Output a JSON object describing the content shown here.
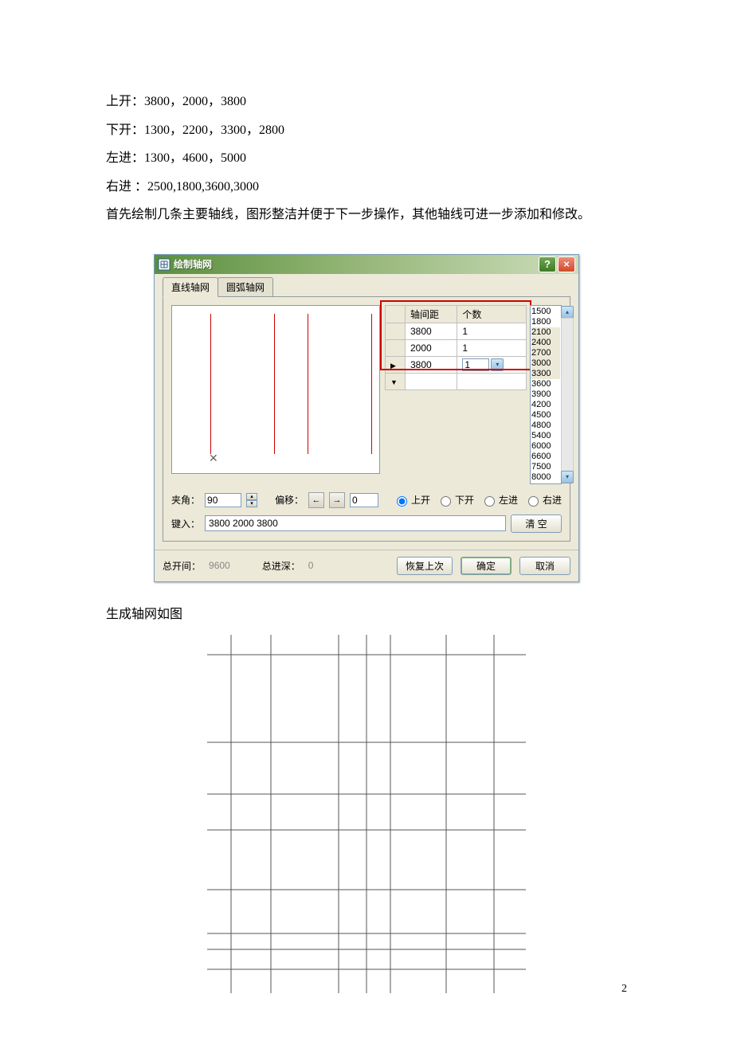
{
  "intro": {
    "l1": "上开：3800，2000，3800",
    "l2": "下开：1300，2200，3300，2800",
    "l3": "左进：1300，4600，5000",
    "l4": "右进 ：2500,1800,3600,3000",
    "l5": "首先绘制几条主要轴线，图形整洁并便于下一步操作，其他轴线可进一步添加和修改。"
  },
  "dialog": {
    "title": "绘制轴网",
    "help": "?",
    "close": "×",
    "tab_straight": "直线轴网",
    "tab_arc": "圆弧轴网",
    "col_dist": "轴间距",
    "col_count": "个数",
    "rows": [
      {
        "dist": "3800",
        "count": "1"
      },
      {
        "dist": "2000",
        "count": "1"
      },
      {
        "dist": "3800",
        "count": "1"
      }
    ],
    "sizes": [
      "1500",
      "1800",
      "2100",
      "2400",
      "2700",
      "3000",
      "3300",
      "3600",
      "3900",
      "4200",
      "4500",
      "4800",
      "5400",
      "6000",
      "6600",
      "7500",
      "8000"
    ],
    "angle_lbl": "夹角：",
    "angle_val": "90",
    "offset_lbl": "偏移：",
    "offset_val": "0",
    "r_top": "上开",
    "r_bottom": "下开",
    "r_left": "左进",
    "r_right": "右进",
    "input_lbl": "键入：",
    "input_val": "3800 2000 3800",
    "clear_btn": "清  空",
    "total_span_lbl": "总开间：",
    "total_span_val": "9600",
    "total_depth_lbl": "总进深：",
    "total_depth_val": "0",
    "restore_btn": "恢复上次",
    "ok_btn": "确定",
    "cancel_btn": "取消"
  },
  "result_label": "生成轴网如图",
  "page_num": "2"
}
